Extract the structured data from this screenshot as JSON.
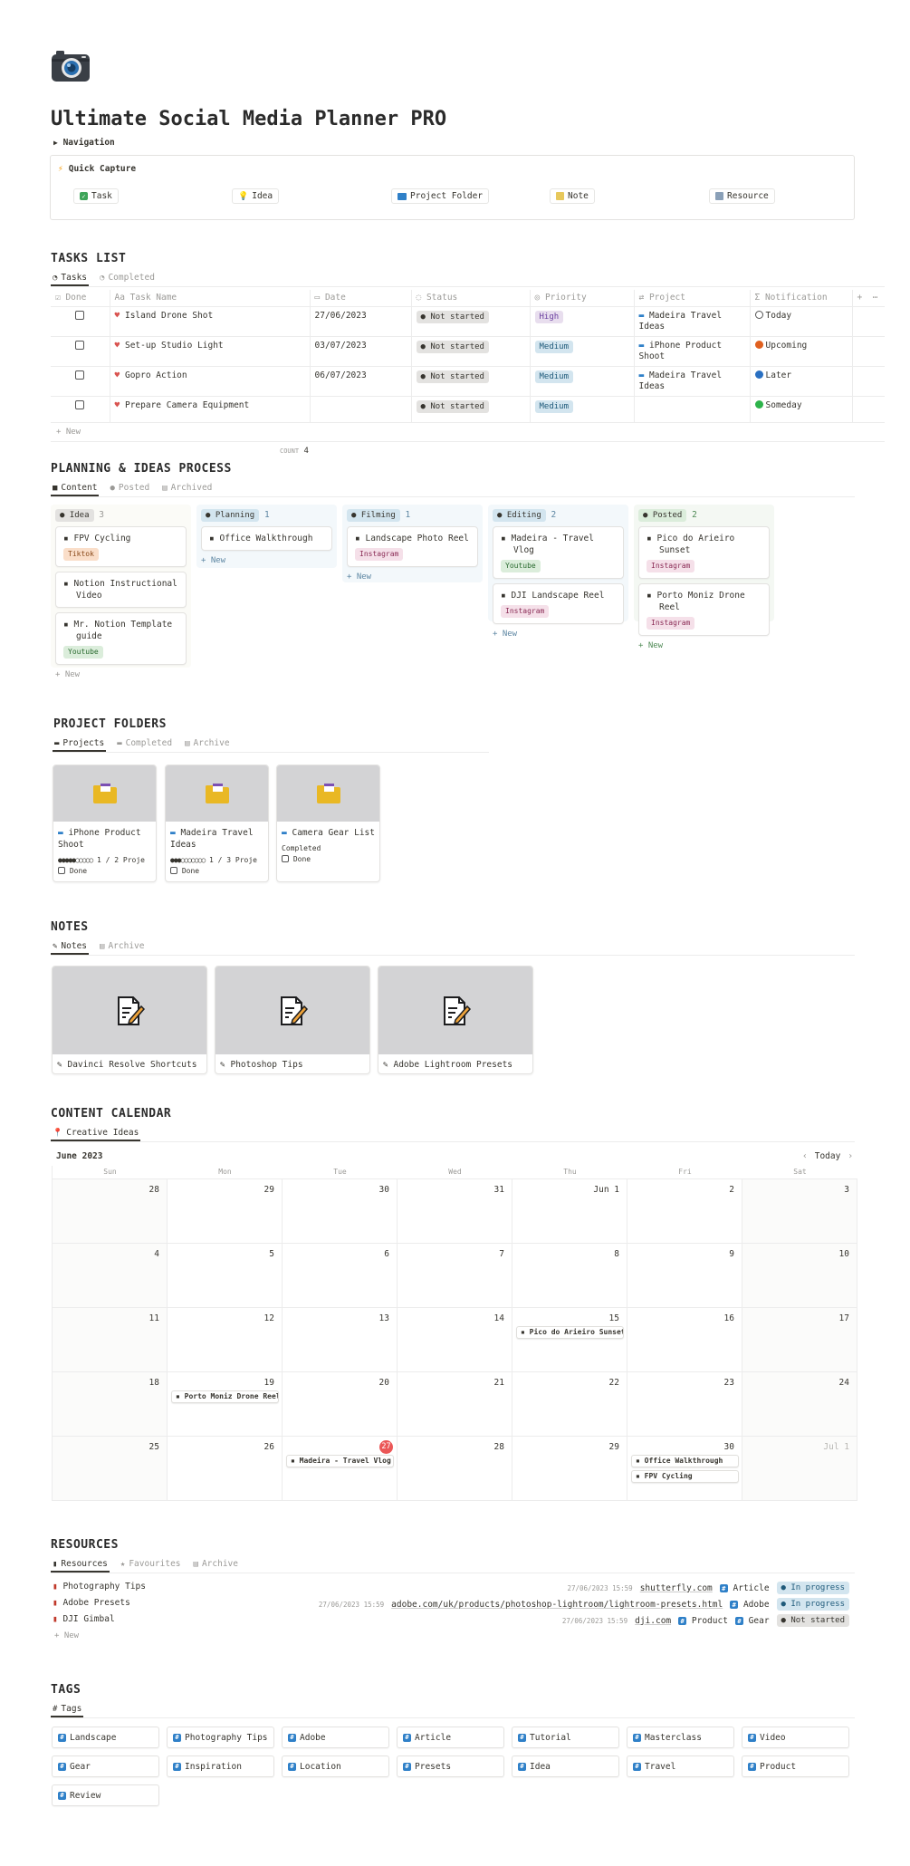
{
  "page": {
    "title": "Ultimate Social Media Planner PRO",
    "icon": "camera-icon",
    "navigation_label": "Navigation"
  },
  "quick_capture": {
    "title": "Quick Capture",
    "buttons": [
      {
        "label": "Task",
        "icon": "check-icon"
      },
      {
        "label": "Idea",
        "icon": "bulb-icon"
      },
      {
        "label": "Project Folder",
        "icon": "folder-icon"
      },
      {
        "label": "Note",
        "icon": "note-icon"
      },
      {
        "label": "Resource",
        "icon": "resource-icon"
      }
    ]
  },
  "tasks": {
    "title": "TASKS LIST",
    "tabs": [
      "Tasks",
      "Completed"
    ],
    "columns": [
      "Done",
      "Task Name",
      "Date",
      "Status",
      "Priority",
      "Project",
      "Notification"
    ],
    "rows": [
      {
        "name": "Island Drone Shot",
        "date": "27/06/2023",
        "status": "Not started",
        "priority": "High",
        "project": "Madeira Travel Ideas",
        "notification": "Today"
      },
      {
        "name": "Set-up Studio Light",
        "date": "03/07/2023",
        "status": "Not started",
        "priority": "Medium",
        "project": "iPhone Product Shoot",
        "notification": "Upcoming"
      },
      {
        "name": "Gopro Action",
        "date": "06/07/2023",
        "status": "Not started",
        "priority": "Medium",
        "project": "Madeira Travel Ideas",
        "notification": "Later"
      },
      {
        "name": "Prepare Camera Equipment",
        "date": "",
        "status": "Not started",
        "priority": "Medium",
        "project": "",
        "notification": "Someday"
      }
    ],
    "new_label": "New",
    "count_label": "COUNT",
    "count_value": "4"
  },
  "planning": {
    "title": "PLANNING & IDEAS PROCESS",
    "tabs": [
      "Content",
      "Posted",
      "Archived"
    ],
    "new_label": "New",
    "columns": [
      {
        "name": "Idea",
        "count": "3",
        "cards": [
          {
            "title": "FPV Cycling",
            "tag": "Tiktok"
          },
          {
            "title": "Notion Instructional Video",
            "tag": ""
          },
          {
            "title": "Mr. Notion Template guide",
            "tag": "Youtube"
          }
        ]
      },
      {
        "name": "Planning",
        "count": "1",
        "cards": [
          {
            "title": "Office Walkthrough",
            "tag": ""
          }
        ]
      },
      {
        "name": "Filming",
        "count": "1",
        "cards": [
          {
            "title": "Landscape Photo Reel",
            "tag": "Instagram"
          }
        ]
      },
      {
        "name": "Editing",
        "count": "2",
        "cards": [
          {
            "title": "Madeira - Travel Vlog",
            "tag": "Youtube"
          },
          {
            "title": "DJI Landscape Reel",
            "tag": "Instagram"
          }
        ]
      },
      {
        "name": "Posted",
        "count": "2",
        "cards": [
          {
            "title": "Pico do Arieiro Sunset",
            "tag": "Instagram"
          },
          {
            "title": "Porto Moniz Drone Reel",
            "tag": "Instagram"
          }
        ]
      }
    ]
  },
  "projects": {
    "title": "PROJECT FOLDERS",
    "tabs": [
      "Projects",
      "Completed",
      "Archive"
    ],
    "cards": [
      {
        "title": "iPhone Product Shoot",
        "progress_text": "1 / 2 Proje",
        "progress": 0.5,
        "done_label": "Done",
        "status": ""
      },
      {
        "title": "Madeira Travel Ideas",
        "progress_text": "1 / 3 Proje",
        "progress": 0.33,
        "done_label": "Done",
        "status": ""
      },
      {
        "title": "Camera Gear List",
        "progress_text": "",
        "progress": null,
        "done_label": "Done",
        "status": "Completed"
      }
    ]
  },
  "notes": {
    "title": "NOTES",
    "tabs": [
      "Notes",
      "Archive"
    ],
    "cards": [
      "Davinci Resolve Shortcuts",
      "Photoshop Tips",
      "Adobe Lightroom Presets"
    ]
  },
  "calendar": {
    "title": "CONTENT CALENDAR",
    "tab": "Creative Ideas",
    "month": "June 2023",
    "today_label": "Today",
    "weekdays": [
      "Sun",
      "Mon",
      "Tue",
      "Wed",
      "Thu",
      "Fri",
      "Sat"
    ],
    "weeks": [
      [
        "28",
        "29",
        "30",
        "31",
        "Jun 1",
        "2",
        "3"
      ],
      [
        "4",
        "5",
        "6",
        "7",
        "8",
        "9",
        "10"
      ],
      [
        "11",
        "12",
        "13",
        "14",
        "15",
        "16",
        "17"
      ],
      [
        "18",
        "19",
        "20",
        "21",
        "22",
        "23",
        "24"
      ],
      [
        "25",
        "26",
        "27",
        "28",
        "29",
        "30",
        "Jul 1"
      ]
    ],
    "today": "27",
    "events": [
      {
        "week": 2,
        "day": 4,
        "label": "Pico do Arieiro Sunset"
      },
      {
        "week": 3,
        "day": 1,
        "label": "Porto Moniz Drone Reel"
      },
      {
        "week": 4,
        "day": 2,
        "label": "Madeira - Travel Vlog"
      },
      {
        "week": 4,
        "day": 5,
        "label": "Office Walkthrough"
      },
      {
        "week": 4,
        "day": 5,
        "label": "FPV Cycling"
      }
    ]
  },
  "resources": {
    "title": "RESOURCES",
    "tabs": [
      "Resources",
      "Favourites",
      "Archive"
    ],
    "new_label": "New",
    "rows": [
      {
        "name": "Photography Tips",
        "date": "27/06/2023 15:59",
        "url": "shutterfly.com",
        "tags": [
          "Article"
        ],
        "status": "In progress"
      },
      {
        "name": "Adobe Presets",
        "date": "27/06/2023 15:59",
        "url": "adobe.com/uk/products/photoshop-lightroom/lightroom-presets.html",
        "tags": [
          "Adobe"
        ],
        "status": "In progress"
      },
      {
        "name": "DJI Gimbal",
        "date": "27/06/2023 15:59",
        "url": "dji.com",
        "tags": [
          "Product",
          "Gear"
        ],
        "status": "Not started"
      }
    ]
  },
  "tags": {
    "title": "TAGS",
    "tab": "Tags",
    "items": [
      "Landscape",
      "Photography Tips",
      "Adobe",
      "Article",
      "Tutorial",
      "Masterclass",
      "Video",
      "Gear",
      "Inspiration",
      "Location",
      "Presets",
      "Idea",
      "Travel",
      "Product",
      "Review"
    ]
  },
  "colors": {
    "high": "#e8deee",
    "medium": "#d3e5ef",
    "not_started": "#e3e2e0",
    "in_progress": "#d3e5ef",
    "tiktok": "#fadec9",
    "instagram": "#f5e0e9",
    "youtube": "#dbeddb",
    "col_idea": "#fbfbf7",
    "col_planning": "#f3f8fb",
    "col_posted": "#f4f8f3",
    "today": "#eb5757"
  }
}
